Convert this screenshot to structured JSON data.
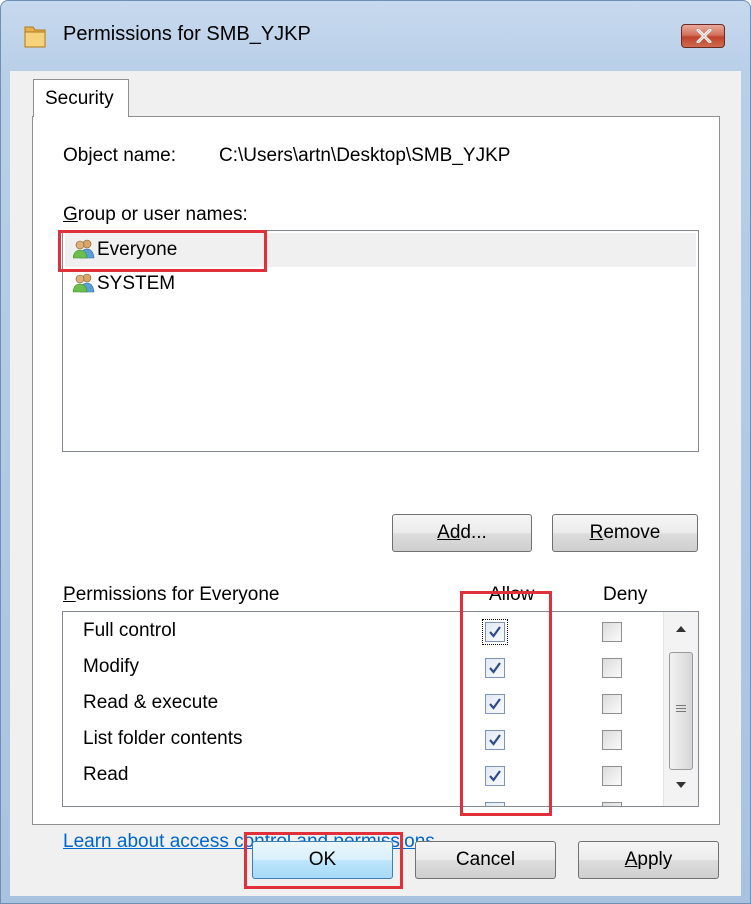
{
  "window": {
    "title": "Permissions for SMB_YJKP",
    "folder_icon": "folder-icon",
    "close_icon": "close-icon"
  },
  "tabs": [
    {
      "label": "Security",
      "selected": true
    }
  ],
  "object": {
    "label": "Object name:",
    "value": "C:\\Users\\artn\\Desktop\\SMB_YJKP"
  },
  "group": {
    "label": "Group or user names:",
    "users": [
      {
        "name": "Everyone",
        "icon": "users-icon",
        "selected": true
      },
      {
        "name": "SYSTEM",
        "icon": "users-icon",
        "selected": false
      }
    ]
  },
  "buttons": {
    "add": "Add...",
    "remove": "Remove",
    "ok": "OK",
    "cancel": "Cancel",
    "apply": "Apply"
  },
  "permissions": {
    "title": "Permissions for Everyone",
    "allow_header": "Allow",
    "deny_header": "Deny",
    "rows": [
      {
        "name": "Full control",
        "allow": true,
        "deny": false
      },
      {
        "name": "Modify",
        "allow": true,
        "deny": false
      },
      {
        "name": "Read & execute",
        "allow": true,
        "deny": false
      },
      {
        "name": "List folder contents",
        "allow": true,
        "deny": false
      },
      {
        "name": "Read",
        "allow": true,
        "deny": false
      }
    ]
  },
  "link": "Learn about access control and permissions",
  "colors": {
    "highlight_box": "#e0303a",
    "link": "#0066cc",
    "checkmark": "#2f4b8c"
  }
}
